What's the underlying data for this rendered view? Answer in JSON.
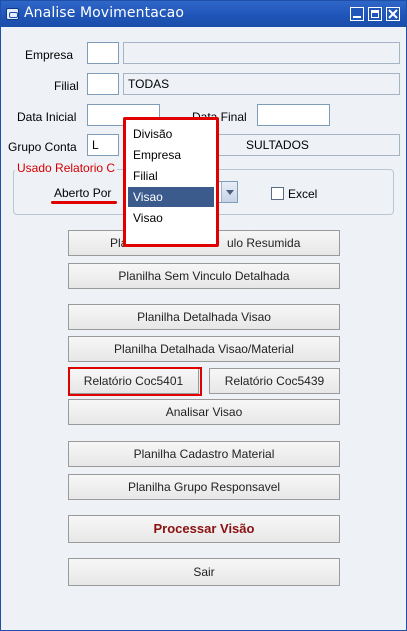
{
  "window": {
    "title": "Analise Movimentacao"
  },
  "form": {
    "empresa": {
      "label": "Empresa",
      "code": "",
      "name": ""
    },
    "filial": {
      "label": "Filial",
      "code": "",
      "name": "TODAS"
    },
    "data_inicial": {
      "label": "Data Inicial",
      "value": ""
    },
    "data_final": {
      "label": "Data Final",
      "value": ""
    },
    "grupo_conta": {
      "label": "Grupo Conta",
      "code": "L",
      "name_visible": "SULTADOS"
    }
  },
  "report_group": {
    "legend": "Usado Relatorio C",
    "combo_label": "Aberto Por",
    "combo_value": "Visao",
    "excel_label": "Excel",
    "excel_checked": false
  },
  "dropdown": {
    "options": [
      "Divisão",
      "Empresa",
      "Filial",
      "Visao",
      "Visao"
    ],
    "selected_index": 3
  },
  "buttons": {
    "resumida": "Planilha Sem Vinculo Resumida",
    "resumida_visible_left": "Pla",
    "resumida_visible_right": "ulo Resumida",
    "detalhada": "Planilha Sem Vinculo Detalhada",
    "det_visao": "Planilha Detalhada Visao",
    "det_visao_material": "Planilha Detalhada Visao/Material",
    "coc5401": "Relatório Coc5401",
    "coc5439": "Relatório Coc5439",
    "analisar": "Analisar Visao",
    "cadastro": "Planilha Cadastro Material",
    "grupo": "Planilha Grupo Responsavel",
    "processar": "Processar Visão",
    "sair": "Sair"
  },
  "colors": {
    "titlebar": "#1e54b7",
    "annotation_red": "#e00000",
    "selection": "#3a5b8c",
    "process_text": "#8b1010"
  }
}
